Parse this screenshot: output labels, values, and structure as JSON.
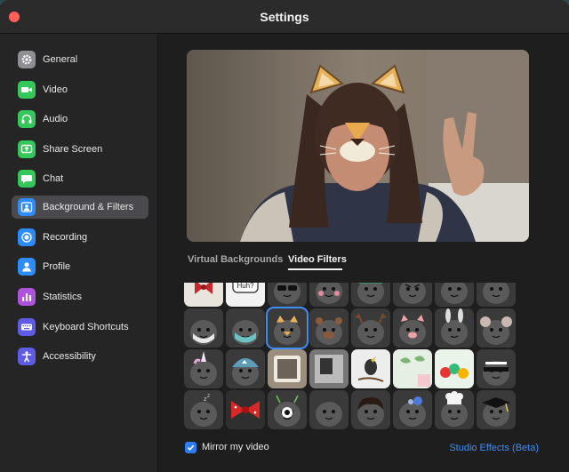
{
  "window": {
    "title": "Settings"
  },
  "sidebar": {
    "items": [
      {
        "label": "General",
        "icon": "gear-icon",
        "color": "#8e8e93"
      },
      {
        "label": "Video",
        "icon": "video-camera-icon",
        "color": "#34c759"
      },
      {
        "label": "Audio",
        "icon": "headphones-icon",
        "color": "#34c759"
      },
      {
        "label": "Share Screen",
        "icon": "share-screen-icon",
        "color": "#34c759"
      },
      {
        "label": "Chat",
        "icon": "chat-bubble-icon",
        "color": "#34c759"
      },
      {
        "label": "Background & Filters",
        "icon": "person-portrait-icon",
        "color": "#2d8cff"
      },
      {
        "label": "Recording",
        "icon": "record-icon",
        "color": "#2d8cff"
      },
      {
        "label": "Profile",
        "icon": "person-icon",
        "color": "#2d8cff"
      },
      {
        "label": "Statistics",
        "icon": "bar-chart-icon",
        "color": "#af52de"
      },
      {
        "label": "Keyboard Shortcuts",
        "icon": "keyboard-icon",
        "color": "#5e5ce6"
      },
      {
        "label": "Accessibility",
        "icon": "accessibility-icon",
        "color": "#5e5ce6"
      }
    ],
    "active_index": 5
  },
  "tabs": [
    {
      "label": "Virtual Backgrounds",
      "active": false
    },
    {
      "label": "Video Filters",
      "active": true
    }
  ],
  "filters": {
    "selected_index": 10,
    "items": [
      "gift-bow-filter",
      "speech-bubble-huh-filter",
      "sunglasses-filter",
      "blush-filter",
      "green-hat-filter",
      "angry-face-filter",
      "winking-face-filter",
      "wide-eyes-filter",
      "face-mask-filter",
      "medical-mask-filter",
      "tiger-filter",
      "bear-filter",
      "reindeer-antlers-filter",
      "pig-filter",
      "bunny-ears-filter",
      "mouse-ears-filter",
      "unicorn-horn-filter",
      "shark-hat-filter",
      "tv-frame-filter",
      "monochrome-frame-filter",
      "bird-frame-filter",
      "leaves-frame-filter",
      "lollipops-frame-filter",
      "glasses-bar-filter",
      "sleepy-zzz-filter",
      "red-polka-bow-filter",
      "alien-eye-filter",
      "plain-face-filter",
      "curly-hair-filter",
      "flower-crown-filter",
      "chef-hat-filter",
      "graduation-cap-filter"
    ],
    "bubble_text": "Huh?"
  },
  "mirror": {
    "label": "Mirror my video",
    "checked": true
  },
  "studio_effects": {
    "label": "Studio Effects (Beta)"
  },
  "colors": {
    "accent": "#2d7df6",
    "close": "#fe5f57"
  }
}
